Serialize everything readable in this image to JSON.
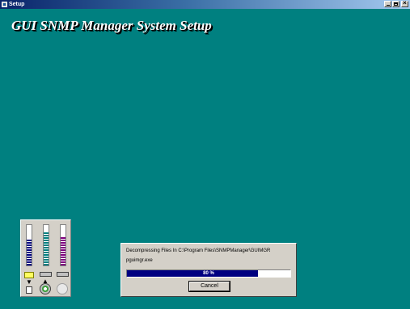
{
  "window": {
    "title": "Setup",
    "controls": {
      "minimize_icon": "minimize-icon",
      "maximize_icon": "maximize-icon",
      "close_icon": "close-icon",
      "close_glyph": "×"
    }
  },
  "banner": {
    "title": "GUI SNMP Manager System Setup"
  },
  "gauges": {
    "disk_fill": 0.65,
    "memory_fill": 0.82,
    "cpu_fill": 0.7,
    "icons": [
      "folder-icon",
      "drive-icon",
      "drive-icon",
      "arrow-icon",
      "cd-icon",
      "globe-icon",
      "document-icon"
    ]
  },
  "progress_dialog": {
    "status_line": "Decompressing Files In C:\\Program Files\\SNMPManager\\GUIMGR",
    "file_name": "pguimgr.exe",
    "percent": 80,
    "percent_label": "80 %",
    "cancel_label": "Cancel"
  },
  "colors": {
    "desktop": "#008080",
    "progress": "#000080",
    "dialog": "#d4d0c8"
  }
}
